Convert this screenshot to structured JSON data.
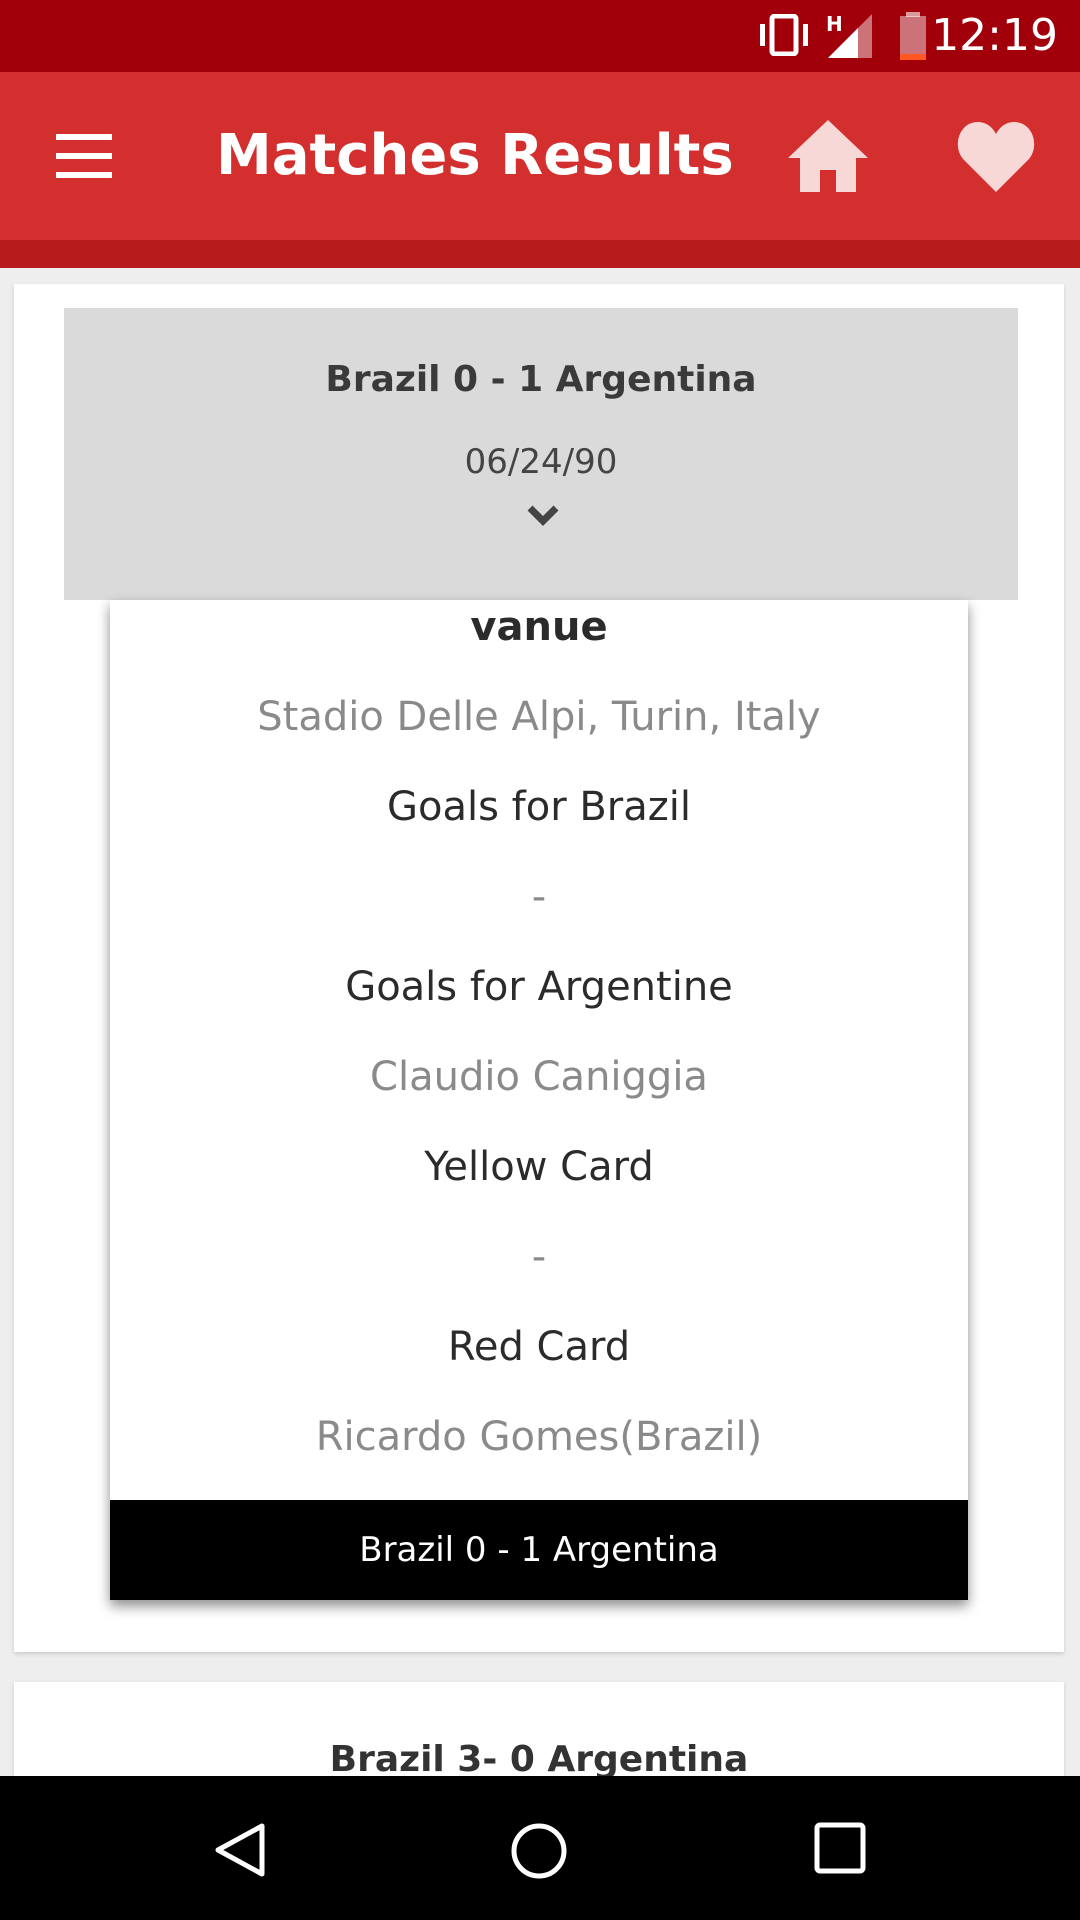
{
  "status_bar": {
    "time": "12:19",
    "network_label": "H"
  },
  "app_bar": {
    "title": "Matches Results"
  },
  "matches": [
    {
      "score": "Brazil 0 - 1 Argentina",
      "date": "06/24/90",
      "details": {
        "venue_label": "vanue",
        "venue_value": "Stadio Delle Alpi, Turin, Italy",
        "goals_team1_label": "Goals for Brazil",
        "goals_team1_value": "-",
        "goals_team2_label": "Goals for Argentine",
        "goals_team2_value": "Claudio Caniggia",
        "yellow_card_label": "Yellow Card",
        "yellow_card_value": "-",
        "red_card_label": "Red Card",
        "red_card_value": "Ricardo Gomes(Brazil)",
        "footer": "Brazil 0 - 1 Argentina"
      }
    },
    {
      "score": "Brazil 3- 0 Argentina"
    }
  ],
  "colors": {
    "status_bar": "#a1000b",
    "app_bar": "#d32f2f",
    "heart": "#f8d7d7"
  }
}
